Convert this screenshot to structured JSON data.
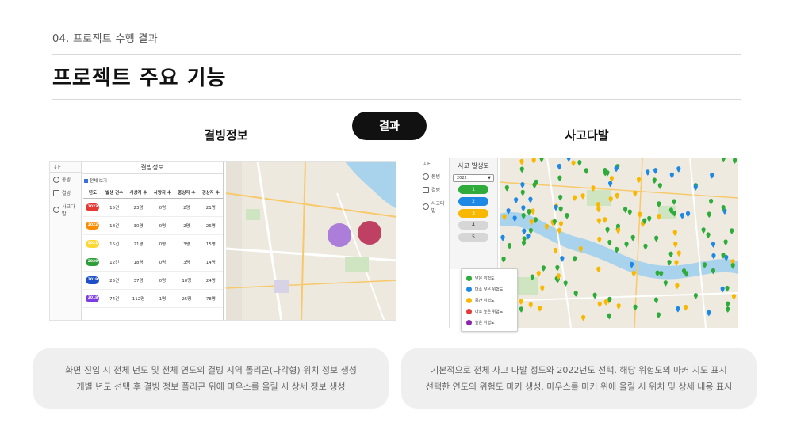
{
  "header": {
    "section_label": "04. 프로젝트 수행 결과",
    "title": "프로젝트 주요 기능",
    "result_label": "결과"
  },
  "panels": {
    "left_title": "결빙정보",
    "right_title": "사고다발"
  },
  "frost_app": {
    "sort_label": "↓F",
    "sidebar": [
      {
        "icon": "info-icon",
        "label": "동빙"
      },
      {
        "icon": "road-icon",
        "label": "결빙"
      },
      {
        "icon": "minus-circle-icon",
        "label": "사고다발"
      }
    ],
    "table_title": "결빙정보",
    "checkbox_label": "전체 보기",
    "columns": [
      "년도",
      "발생 건수",
      "사상자 수",
      "사망자 수",
      "중상자 수",
      "경상자 수"
    ],
    "rows": [
      {
        "year": "2023",
        "color": "#e53935",
        "cells": [
          "15건",
          "23명",
          "0명",
          "2명",
          "21명"
        ]
      },
      {
        "year": "2022",
        "color": "#fb8c00",
        "cells": [
          "18건",
          "30명",
          "0명",
          "2명",
          "26명"
        ]
      },
      {
        "year": "2021",
        "color": "#fdd835",
        "cells": [
          "15건",
          "21명",
          "0명",
          "3명",
          "15명"
        ]
      },
      {
        "year": "2020",
        "color": "#2e9e3a",
        "cells": [
          "12건",
          "18명",
          "0명",
          "3명",
          "14명"
        ]
      },
      {
        "year": "2019",
        "color": "#1e4fc9",
        "cells": [
          "25건",
          "37명",
          "0명",
          "10명",
          "24명"
        ]
      },
      {
        "year": "2018",
        "color": "#7b3ee0",
        "cells": [
          "74건",
          "112명",
          "1명",
          "25명",
          "78명"
        ]
      }
    ]
  },
  "accident_app": {
    "sort_label": "↓F",
    "sidebar": [
      {
        "icon": "info-icon",
        "label": "동빙"
      },
      {
        "icon": "road-icon",
        "label": "결빙"
      },
      {
        "icon": "minus-circle-icon",
        "label": "사고다발"
      }
    ],
    "control_title": "사고 발생도",
    "year_selected": "2022",
    "levels": [
      {
        "label": "1",
        "color": "#2eab3b",
        "text": "#ffffff"
      },
      {
        "label": "2",
        "color": "#1e88e5",
        "text": "#ffffff"
      },
      {
        "label": "3",
        "color": "#f9b800",
        "text": "#ffffff"
      },
      {
        "label": "4",
        "color": "#d6d6d6",
        "text": "#333333"
      },
      {
        "label": "5",
        "color": "#d6d6d6",
        "text": "#333333"
      }
    ],
    "legend": [
      {
        "color": "#2eab3b",
        "label": "낮은 위험도"
      },
      {
        "color": "#1e88e5",
        "label": "다소 낮은 위험도"
      },
      {
        "color": "#f9b800",
        "label": "중간 위험도"
      },
      {
        "color": "#e53935",
        "label": "다소 높은 위험도"
      },
      {
        "color": "#8e24aa",
        "label": "높은 위험도"
      }
    ]
  },
  "captions": {
    "left": [
      "화면 진입 시 전체 년도 및 전체 연도의 결빙 지역 폴리곤(다각형) 위치 정보 생성",
      "개별 년도 선택 후 결빙 정보 폴리곤 위에 마우스를 올릴 시 상세 정보 생성"
    ],
    "right": [
      "기본적으로 전체 사고 다발 정도와 2022년도 선택. 해당 위험도의 마커 지도 표시",
      "선택한 연도의 위험도 마커 생성. 마우스를 마커 위에 올릴 시 위치 및 상세 내용 표시"
    ]
  }
}
